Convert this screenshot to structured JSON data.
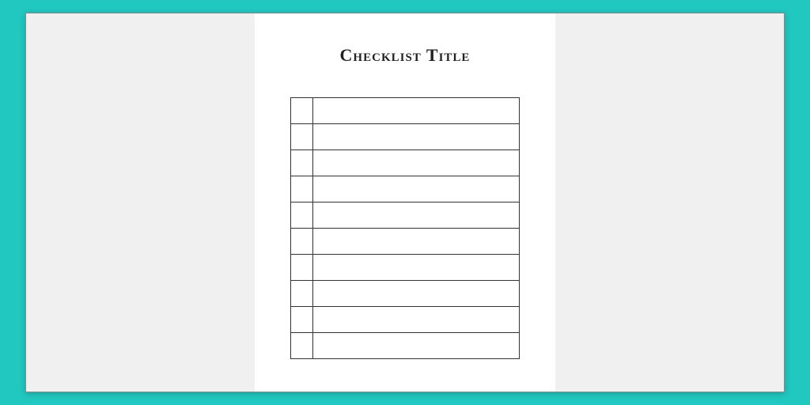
{
  "document": {
    "title": "Checklist Title",
    "rows": [
      {
        "check": "",
        "item": ""
      },
      {
        "check": "",
        "item": ""
      },
      {
        "check": "",
        "item": ""
      },
      {
        "check": "",
        "item": ""
      },
      {
        "check": "",
        "item": ""
      },
      {
        "check": "",
        "item": ""
      },
      {
        "check": "",
        "item": ""
      },
      {
        "check": "",
        "item": ""
      },
      {
        "check": "",
        "item": ""
      },
      {
        "check": "",
        "item": ""
      }
    ]
  }
}
